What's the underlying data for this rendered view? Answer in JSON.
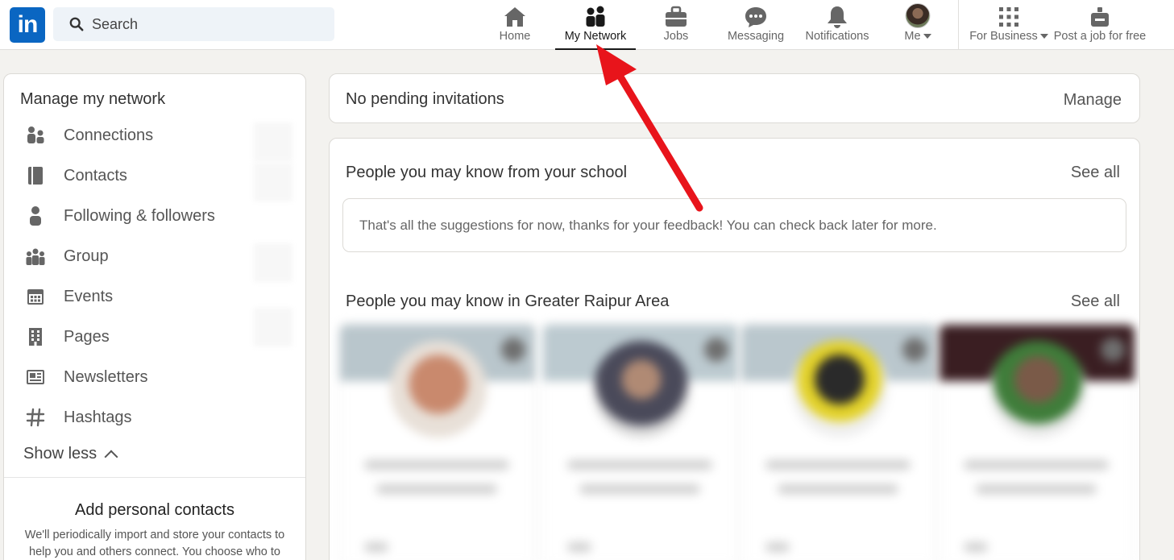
{
  "search": {
    "placeholder": "Search"
  },
  "nav": {
    "home": "Home",
    "my_network": "My Network",
    "jobs": "Jobs",
    "messaging": "Messaging",
    "notifications": "Notifications",
    "me": "Me",
    "for_business": "For Business",
    "post_job": "Post a job for free"
  },
  "sidebar": {
    "title": "Manage my network",
    "items": [
      {
        "label": "Connections",
        "icon": "people-icon"
      },
      {
        "label": "Contacts",
        "icon": "address-book-icon"
      },
      {
        "label": "Following & followers",
        "icon": "person-icon"
      },
      {
        "label": "Group",
        "icon": "group-icon"
      },
      {
        "label": "Events",
        "icon": "calendar-icon"
      },
      {
        "label": "Pages",
        "icon": "building-icon"
      },
      {
        "label": "Newsletters",
        "icon": "newsletter-icon"
      },
      {
        "label": "Hashtags",
        "icon": "hashtag-icon"
      }
    ],
    "show_less": "Show less",
    "add_contacts_title": "Add personal contacts",
    "add_contacts_desc": "We'll periodically import and store your contacts to help you and others connect. You choose who to"
  },
  "invitations": {
    "title": "No pending invitations",
    "manage": "Manage"
  },
  "school_section": {
    "title": "People you may know from your school",
    "see_all": "See all",
    "notice": "That's all the suggestions for now, thanks for your feedback! You can check back later for more."
  },
  "area_section": {
    "title": "People you may know in Greater Raipur Area",
    "see_all": "See all"
  },
  "colors": {
    "brand": "#0a66c2",
    "annotation_arrow": "#e8141b"
  }
}
